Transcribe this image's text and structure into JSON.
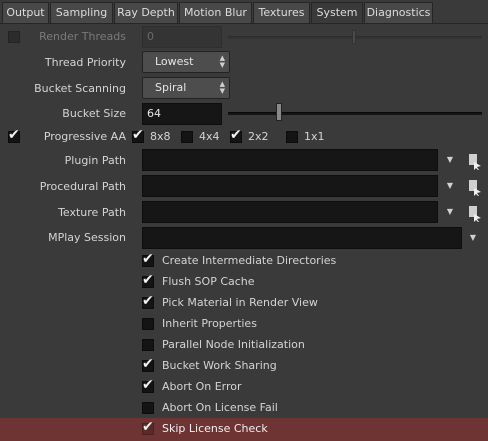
{
  "tabs": [
    "Output",
    "Sampling",
    "Ray Depth",
    "Motion Blur",
    "Textures",
    "System",
    "Diagnostics"
  ],
  "active_tab": "System",
  "render_threads": {
    "label": "Render Threads",
    "value": "0"
  },
  "thread_priority": {
    "label": "Thread Priority",
    "value": "Lowest"
  },
  "bucket_scanning": {
    "label": "Bucket Scanning",
    "value": "Spiral"
  },
  "bucket_size": {
    "label": "Bucket Size",
    "value": "64",
    "slider_fraction": 0.2
  },
  "progressive_aa": {
    "label": "Progressive AA",
    "options": [
      {
        "label": "8x8",
        "checked": true
      },
      {
        "label": "4x4",
        "checked": false
      },
      {
        "label": "2x2",
        "checked": true
      },
      {
        "label": "1x1",
        "checked": false
      }
    ]
  },
  "plugin_path": {
    "label": "Plugin Path",
    "value": ""
  },
  "procedural_path": {
    "label": "Procedural Path",
    "value": ""
  },
  "texture_path": {
    "label": "Texture Path",
    "value": ""
  },
  "mplay_session": {
    "label": "MPlay Session",
    "value": ""
  },
  "toggles": [
    {
      "label": "Create Intermediate Directories",
      "checked": true
    },
    {
      "label": "Flush SOP Cache",
      "checked": true
    },
    {
      "label": "Pick Material in Render View",
      "checked": true
    },
    {
      "label": "Inherit Properties",
      "checked": false
    },
    {
      "label": "Parallel Node Initialization",
      "checked": false
    },
    {
      "label": "Bucket Work Sharing",
      "checked": true
    },
    {
      "label": "Abort On Error",
      "checked": true
    },
    {
      "label": "Abort On License Fail",
      "checked": false
    },
    {
      "label": "Skip License Check",
      "checked": true
    }
  ],
  "colors": {
    "background": "#3a3a3a",
    "highlight": "#6e3434",
    "field": "#161616"
  }
}
